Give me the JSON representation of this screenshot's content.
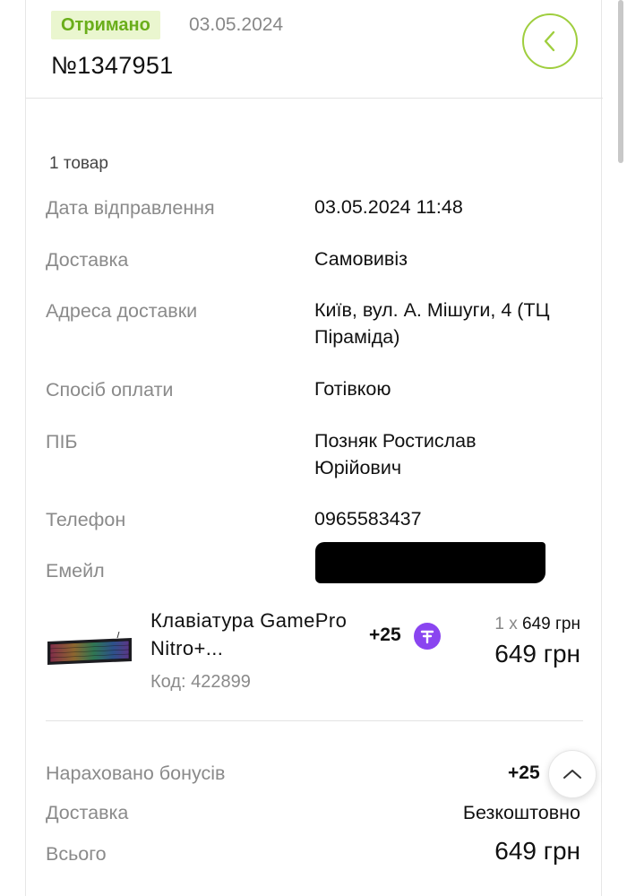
{
  "order": {
    "status": "Отримано",
    "date": "03.05.2024",
    "number": "№1347951",
    "items_count": "1 товар"
  },
  "details": [
    {
      "label": "Дата відправлення",
      "value": "03.05.2024 11:48"
    },
    {
      "label": "Доставка",
      "value": "Самовивіз"
    },
    {
      "label": "Адреса доставки",
      "value": "Київ, вул. А. Мішуги, 4 (ТЦ Піраміда)"
    },
    {
      "label": "Спосіб оплати",
      "value": "Готівкою"
    },
    {
      "label": "ПІБ",
      "value": "Позняк Ростислав Юрійович"
    },
    {
      "label": "Телефон",
      "value": "0965583437"
    },
    {
      "label": "Емейл",
      "value": ""
    }
  ],
  "product": {
    "name": "Клавіатура GamePro Nitro+...",
    "code": "Код: 422899",
    "bonus": "+25",
    "quantity": "1 х",
    "unit_price": "649 грн",
    "total": "649 грн"
  },
  "summary": {
    "bonus_label": "Нараховано бонусів",
    "bonus_value": "+25",
    "delivery_label": "Доставка",
    "delivery_value": "Безкоштовно",
    "total_label": "Всього",
    "total_value": "649 грн"
  },
  "colors": {
    "status_text": "#6aae1a",
    "status_bg": "#eaf6cf",
    "back_button_border": "#9fce3e",
    "bonus_coin": "#8a45f0"
  },
  "icons": {
    "back": "chevron-left-icon",
    "bonus": "bonus-coin-icon",
    "scroll_top": "chevron-up-icon"
  }
}
